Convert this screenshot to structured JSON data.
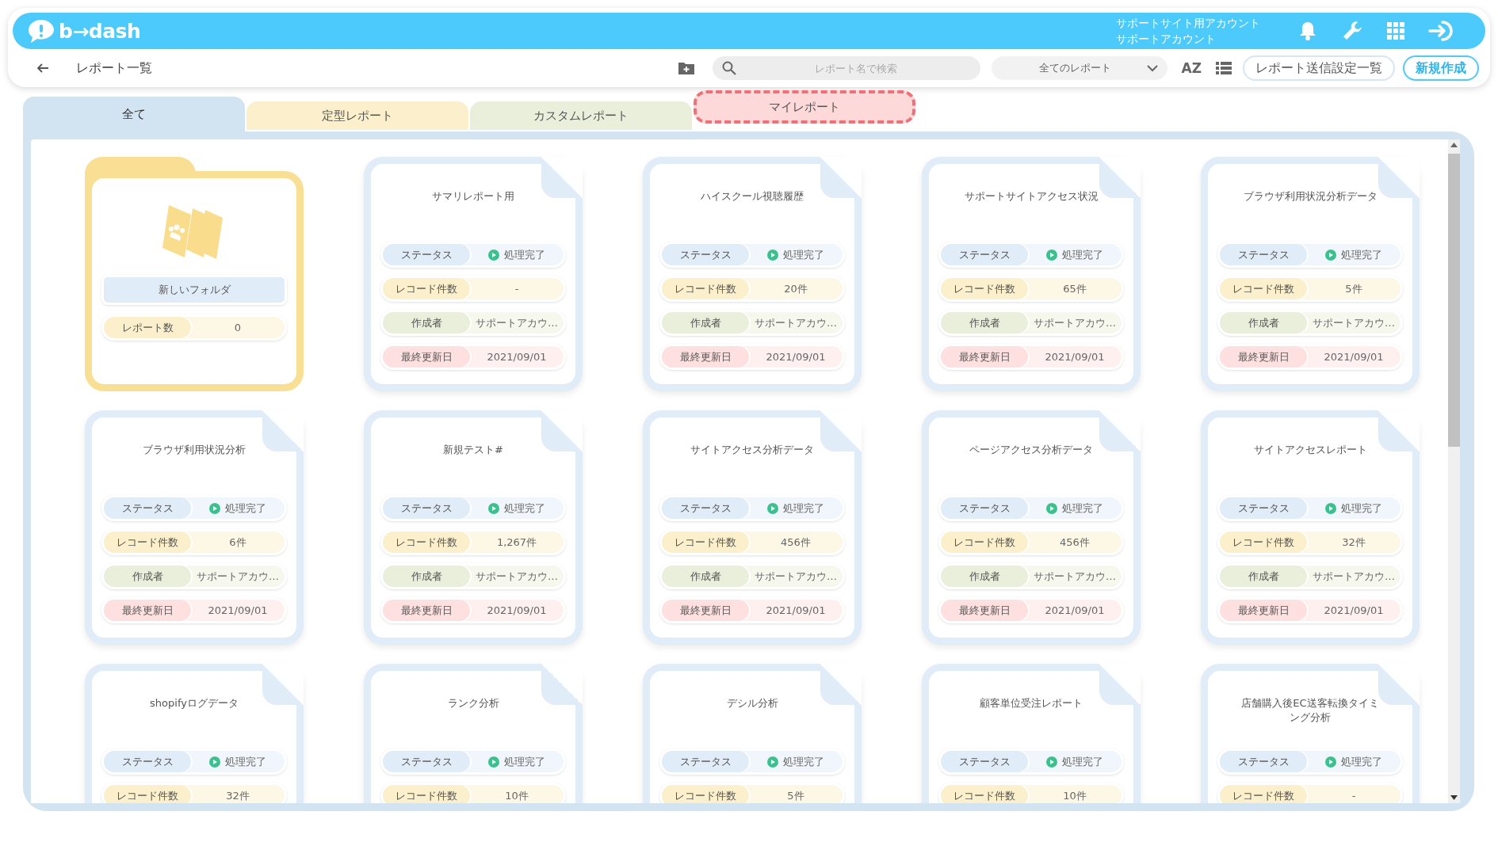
{
  "header": {
    "logo_text": "b→dash",
    "account_lines": [
      "サポートサイト用アカウント",
      "サポートアカウント"
    ]
  },
  "toolbar": {
    "page_title": "レポート一覧",
    "search": {
      "placeholder": "レポート名で検索"
    },
    "filter": {
      "value": "全てのレポート"
    },
    "sort_label": "AZ",
    "buttons": [
      {
        "label": "レポート送信設定一覧",
        "kind": "outline"
      },
      {
        "label": "新規作成",
        "kind": "primary"
      }
    ]
  },
  "tabs": [
    {
      "label": "全て",
      "selected": true,
      "highlighted": false,
      "color": "#d2e3f2"
    },
    {
      "label": "定型レポート",
      "selected": false,
      "highlighted": false,
      "color": "#fcf0cc"
    },
    {
      "label": "カスタムレポート",
      "selected": false,
      "highlighted": false,
      "color": "#eaefdb"
    },
    {
      "label": "マイレポート",
      "selected": false,
      "highlighted": true,
      "color": "#fdd9d9"
    }
  ],
  "cards": [
    {
      "kind": "folder",
      "title": "新しいフォルダ",
      "rows": [
        {
          "kind": "count",
          "label": "レポート数",
          "value": "0"
        }
      ]
    },
    {
      "kind": "report",
      "title": "サマリレポート用",
      "rows": [
        {
          "kind": "status",
          "label": "ステータス",
          "value": "処理完了"
        },
        {
          "kind": "count",
          "label": "レコード件数",
          "value": "-"
        },
        {
          "kind": "creator",
          "label": "作成者",
          "value": "サポートアカウ…"
        },
        {
          "kind": "date",
          "label": "最終更新日",
          "value": "2021/09/01"
        }
      ]
    },
    {
      "kind": "report",
      "title": "ハイスクール視聴履歴",
      "rows": [
        {
          "kind": "status",
          "label": "ステータス",
          "value": "処理完了"
        },
        {
          "kind": "count",
          "label": "レコード件数",
          "value": "20件"
        },
        {
          "kind": "creator",
          "label": "作成者",
          "value": "サポートアカウ…"
        },
        {
          "kind": "date",
          "label": "最終更新日",
          "value": "2021/09/01"
        }
      ]
    },
    {
      "kind": "report",
      "title": "サポートサイトアクセス状況",
      "rows": [
        {
          "kind": "status",
          "label": "ステータス",
          "value": "処理完了"
        },
        {
          "kind": "count",
          "label": "レコード件数",
          "value": "65件"
        },
        {
          "kind": "creator",
          "label": "作成者",
          "value": "サポートアカウ…"
        },
        {
          "kind": "date",
          "label": "最終更新日",
          "value": "2021/09/01"
        }
      ]
    },
    {
      "kind": "report",
      "title": "ブラウザ利用状況分析データ",
      "rows": [
        {
          "kind": "status",
          "label": "ステータス",
          "value": "処理完了"
        },
        {
          "kind": "count",
          "label": "レコード件数",
          "value": "5件"
        },
        {
          "kind": "creator",
          "label": "作成者",
          "value": "サポートアカウ…"
        },
        {
          "kind": "date",
          "label": "最終更新日",
          "value": "2021/09/01"
        }
      ]
    },
    {
      "kind": "report",
      "title": "ブラウザ利用状況分析",
      "rows": [
        {
          "kind": "status",
          "label": "ステータス",
          "value": "処理完了"
        },
        {
          "kind": "count",
          "label": "レコード件数",
          "value": "6件"
        },
        {
          "kind": "creator",
          "label": "作成者",
          "value": "サポートアカウ…"
        },
        {
          "kind": "date",
          "label": "最終更新日",
          "value": "2021/09/01"
        }
      ]
    },
    {
      "kind": "report",
      "title": "新規テスト#",
      "rows": [
        {
          "kind": "status",
          "label": "ステータス",
          "value": "処理完了"
        },
        {
          "kind": "count",
          "label": "レコード件数",
          "value": "1,267件"
        },
        {
          "kind": "creator",
          "label": "作成者",
          "value": "サポートアカウ…"
        },
        {
          "kind": "date",
          "label": "最終更新日",
          "value": "2021/09/01"
        }
      ]
    },
    {
      "kind": "report",
      "title": "サイトアクセス分析データ",
      "rows": [
        {
          "kind": "status",
          "label": "ステータス",
          "value": "処理完了"
        },
        {
          "kind": "count",
          "label": "レコード件数",
          "value": "456件"
        },
        {
          "kind": "creator",
          "label": "作成者",
          "value": "サポートアカウ…"
        },
        {
          "kind": "date",
          "label": "最終更新日",
          "value": "2021/09/01"
        }
      ]
    },
    {
      "kind": "report",
      "title": "ページアクセス分析データ",
      "rows": [
        {
          "kind": "status",
          "label": "ステータス",
          "value": "処理完了"
        },
        {
          "kind": "count",
          "label": "レコード件数",
          "value": "456件"
        },
        {
          "kind": "creator",
          "label": "作成者",
          "value": "サポートアカウ…"
        },
        {
          "kind": "date",
          "label": "最終更新日",
          "value": "2021/09/01"
        }
      ]
    },
    {
      "kind": "report",
      "title": "サイトアクセスレポート",
      "rows": [
        {
          "kind": "status",
          "label": "ステータス",
          "value": "処理完了"
        },
        {
          "kind": "count",
          "label": "レコード件数",
          "value": "32件"
        },
        {
          "kind": "creator",
          "label": "作成者",
          "value": "サポートアカウ…"
        },
        {
          "kind": "date",
          "label": "最終更新日",
          "value": "2021/09/01"
        }
      ]
    },
    {
      "kind": "report",
      "title": "shopifyログデータ",
      "rows": [
        {
          "kind": "status",
          "label": "ステータス",
          "value": "処理完了"
        },
        {
          "kind": "count",
          "label": "レコード件数",
          "value": "32件"
        }
      ]
    },
    {
      "kind": "report",
      "title": "ランク分析",
      "rows": [
        {
          "kind": "status",
          "label": "ステータス",
          "value": "処理完了"
        },
        {
          "kind": "count",
          "label": "レコード件数",
          "value": "10件"
        }
      ]
    },
    {
      "kind": "report",
      "title": "デシル分析",
      "rows": [
        {
          "kind": "status",
          "label": "ステータス",
          "value": "処理完了"
        },
        {
          "kind": "count",
          "label": "レコード件数",
          "value": "5件"
        }
      ]
    },
    {
      "kind": "report",
      "title": "顧客単位受注レポート",
      "rows": [
        {
          "kind": "status",
          "label": "ステータス",
          "value": "処理完了"
        },
        {
          "kind": "count",
          "label": "レコード件数",
          "value": "10件"
        }
      ]
    },
    {
      "kind": "report",
      "title": "店舗購入後EC送客転換タイミング分析",
      "rows": [
        {
          "kind": "status",
          "label": "ステータス",
          "value": "処理完了"
        },
        {
          "kind": "count",
          "label": "レコード件数",
          "value": "-"
        }
      ]
    }
  ]
}
